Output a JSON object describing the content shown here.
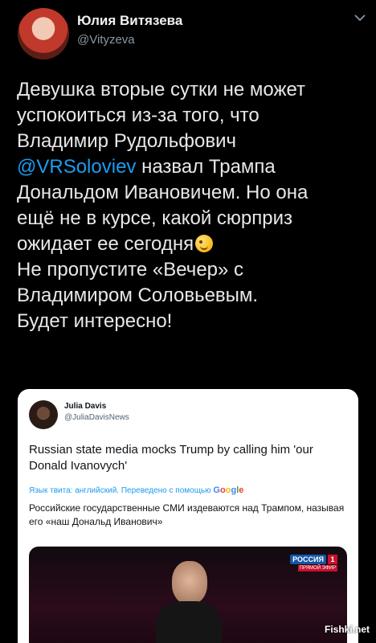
{
  "tweet": {
    "author_name": "Юлия Витязева",
    "author_handle": "@Vityzeva",
    "text_before": "Девушка вторые сутки не может\nуспокоиться из-за того, что\nВладимир Рудольфович\n",
    "mention": "@VRSoloviev",
    "text_middle": " назвал Трампа\nДональдом Ивановичем. Но она\nещё не в курсе, какой сюрприз\nожидает ее сегодня",
    "emoji": "winking-face",
    "text_after": "\nНе пропустите «Вечер» с\nВладимиром Соловьевым.\nБудет интересно!"
  },
  "quoted": {
    "author_name": "Julia Davis",
    "author_handle": "@JuliaDavisNews",
    "text": "Russian state media mocks Trump by calling him 'our Donald Ivanovych'",
    "translate_prefix": "Язык твита: английский. Переведено с помощью ",
    "google": [
      "G",
      "o",
      "o",
      "g",
      "l",
      "e"
    ],
    "translation": "Российские государственные СМИ издеваются над Трампом, называя его «наш Дональд Иванович»",
    "media": {
      "channel": "РОССИЯ",
      "channel_number": "1",
      "live": "ПРЯМОЙ ЭФИР"
    }
  },
  "watermark": "Fishki.net",
  "colors": {
    "background": "#000000",
    "mention": "#1d9bf0",
    "card": "#ffffff"
  }
}
